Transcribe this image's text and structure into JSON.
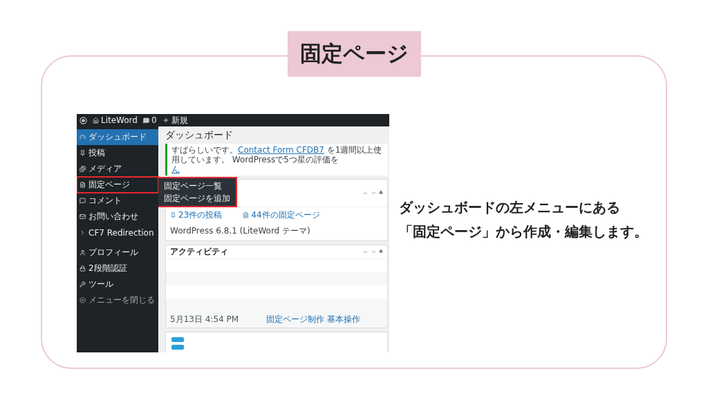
{
  "title_tag": "固定ページ",
  "caption": [
    "ダッシュボードの左メニューにある",
    "「固定ページ」から作成・編集します。"
  ],
  "screenshot": {
    "admin_bar": {
      "site": "LiteWord",
      "comments": "0",
      "new": "新規"
    },
    "sidebar": {
      "groups": [
        [
          {
            "label": "ダッシュボード",
            "selected": true,
            "outlined": false
          },
          {
            "label": "投稿",
            "selected": false,
            "outlined": false
          },
          {
            "label": "メディア",
            "selected": false,
            "outlined": false
          },
          {
            "label": "固定ページ",
            "selected": false,
            "outlined": true,
            "submenu": [
              "固定ページ一覧",
              "固定ページを追加"
            ]
          },
          {
            "label": "コメント",
            "selected": false,
            "outlined": false
          },
          {
            "label": "お問い合わせ",
            "selected": false,
            "outlined": false
          },
          {
            "label": "CF7 Redirection",
            "selected": false,
            "outlined": false
          }
        ],
        [
          {
            "label": "プロフィール",
            "selected": false,
            "outlined": false
          },
          {
            "label": "2段階認証",
            "selected": false,
            "outlined": false
          },
          {
            "label": "ツール",
            "selected": false,
            "outlined": false
          },
          {
            "label": "メニューを閉じる",
            "selected": false,
            "outlined": false
          }
        ]
      ]
    },
    "page_title": "ダッシュボード",
    "notice": {
      "before": "すばらしいです。",
      "link": "Contact Form CFDB7",
      "after": " を1週間以上使用しています。 WordPressで5つ星の評価を",
      "link_2": "ん"
    },
    "panels": [
      {
        "kind": "glance",
        "items": [
          "23件の投稿",
          "44件の固定ページ"
        ],
        "footer": "WordPress 6.8.1 (LiteWord テーマ)"
      },
      {
        "kind": "activity",
        "title": "アクティビティ",
        "date": "5月13日 4:54 PM",
        "link": "固定ページ制作 基本操作"
      },
      {
        "kind": "blank"
      }
    ]
  }
}
